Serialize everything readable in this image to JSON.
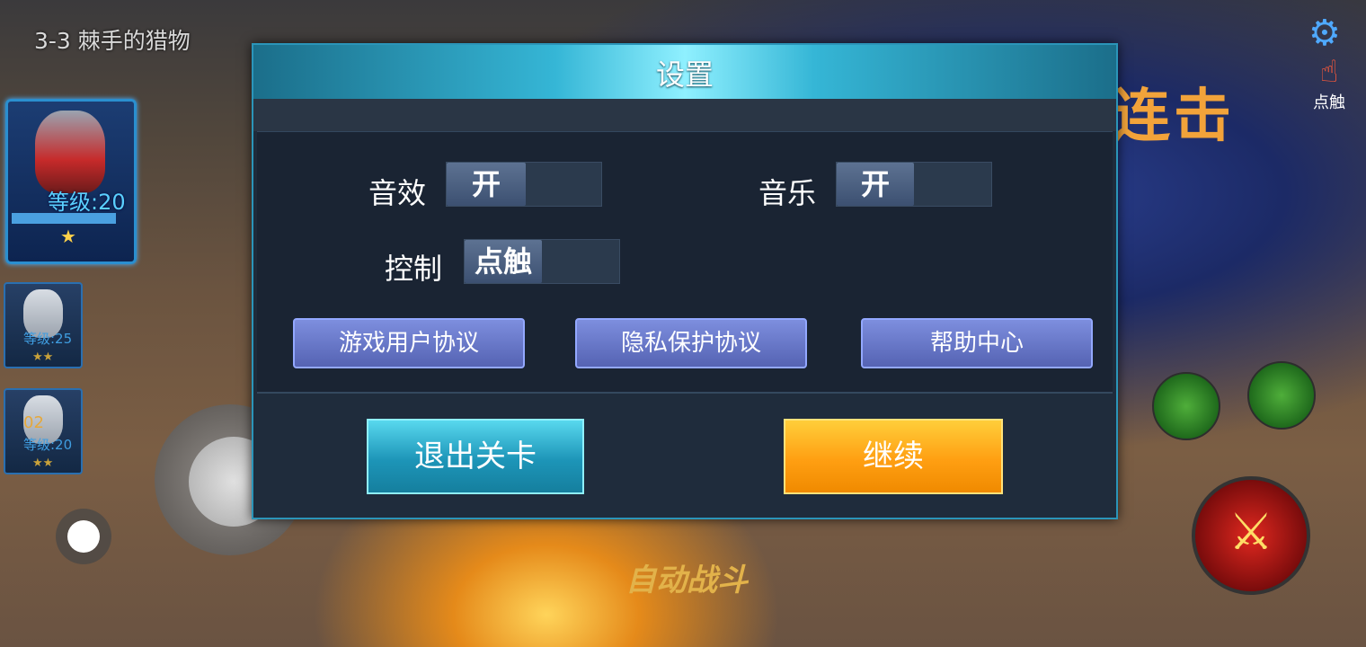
{
  "stage": {
    "title": "3-3 棘手的猎物"
  },
  "team": {
    "main_hero": {
      "level": "等级:20",
      "stars": "★"
    },
    "members": [
      {
        "level": "等级:25",
        "stars": "★★"
      },
      {
        "level": "等级:20",
        "stars": "★★",
        "badge": "02"
      }
    ]
  },
  "hud": {
    "combo_text": "连击",
    "touch_label": "点触",
    "auto_fight": "自动战斗"
  },
  "settings": {
    "title": "设置",
    "sound_label": "音效",
    "sound_value": "开",
    "music_label": "音乐",
    "music_value": "开",
    "control_label": "控制",
    "control_value": "点触",
    "user_agreement": "游戏用户协议",
    "privacy_agreement": "隐私保护协议",
    "help_center": "帮助中心",
    "exit_label": "退出关卡",
    "continue_label": "继续"
  },
  "colors": {
    "dialog_border": "#2b95b9",
    "exit_button": "#1d95b8",
    "continue_button": "#ff9f12",
    "agreement_button": "#5563b3"
  }
}
